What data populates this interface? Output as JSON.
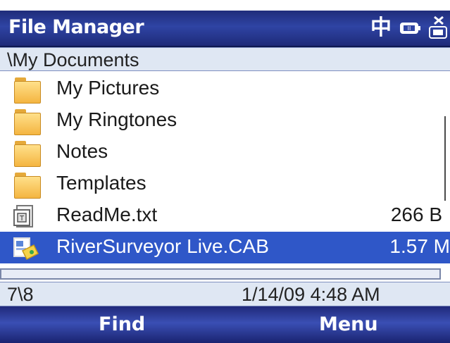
{
  "title_bar": {
    "title": "File Manager",
    "ime_indicator": "中",
    "icons": [
      "ime-indicator",
      "battery-icon",
      "signal-off-icon"
    ]
  },
  "path_bar": {
    "path": "\\My Documents"
  },
  "files": [
    {
      "name": "My Pictures",
      "size": "",
      "type": "folder",
      "icon": "folder-icon",
      "selected": false
    },
    {
      "name": "My Ringtones",
      "size": "",
      "type": "folder",
      "icon": "folder-icon",
      "selected": false
    },
    {
      "name": "Notes",
      "size": "",
      "type": "folder",
      "icon": "folder-icon",
      "selected": false
    },
    {
      "name": "Templates",
      "size": "",
      "type": "folder",
      "icon": "folder-icon",
      "selected": false
    },
    {
      "name": "ReadMe.txt",
      "size": "266 B",
      "type": "file",
      "icon": "text-file-icon",
      "selected": false
    },
    {
      "name": "RiverSurveyor Live.CAB",
      "size": "1.57 M",
      "type": "file",
      "icon": "cab-installer-icon",
      "selected": true
    }
  ],
  "status_bar": {
    "position": "7\\8",
    "timestamp": "1/14/09 4:48 AM"
  },
  "softkeys": {
    "left": "Find",
    "right": "Menu"
  },
  "colors": {
    "title_bar": "#2f44a4",
    "selection": "#2f57c8",
    "path_bar": "#dfe7f3"
  }
}
